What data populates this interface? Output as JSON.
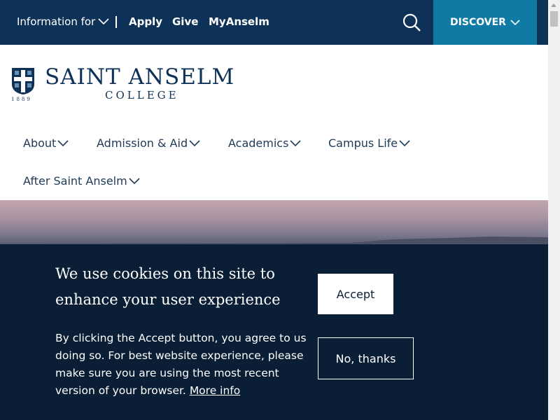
{
  "utility_bar": {
    "info_label": "Information for",
    "links": [
      "Apply",
      "Give",
      "MyAnselm"
    ],
    "search_icon": "search-icon",
    "discover_label": "DISCOVER"
  },
  "logo": {
    "name": "SAINT ANSELM",
    "subtitle": "COLLEGE",
    "year": "1889"
  },
  "nav": {
    "items": [
      "About",
      "Admission & Aid",
      "Academics",
      "Campus Life",
      "After Saint Anselm"
    ]
  },
  "cookie_banner": {
    "headline": "We use cookies on this site to enhance your user experience",
    "body": "By clicking the Accept button, you agree to us doing so. For best website experience, please make sure you are using the most recent version of your browser.",
    "more_info": "More info",
    "accept_label": "Accept",
    "decline_label": "No, thanks"
  },
  "colors": {
    "navy": "#0e3257",
    "teal": "#0f7aa3",
    "banner": "#0a1e36"
  }
}
